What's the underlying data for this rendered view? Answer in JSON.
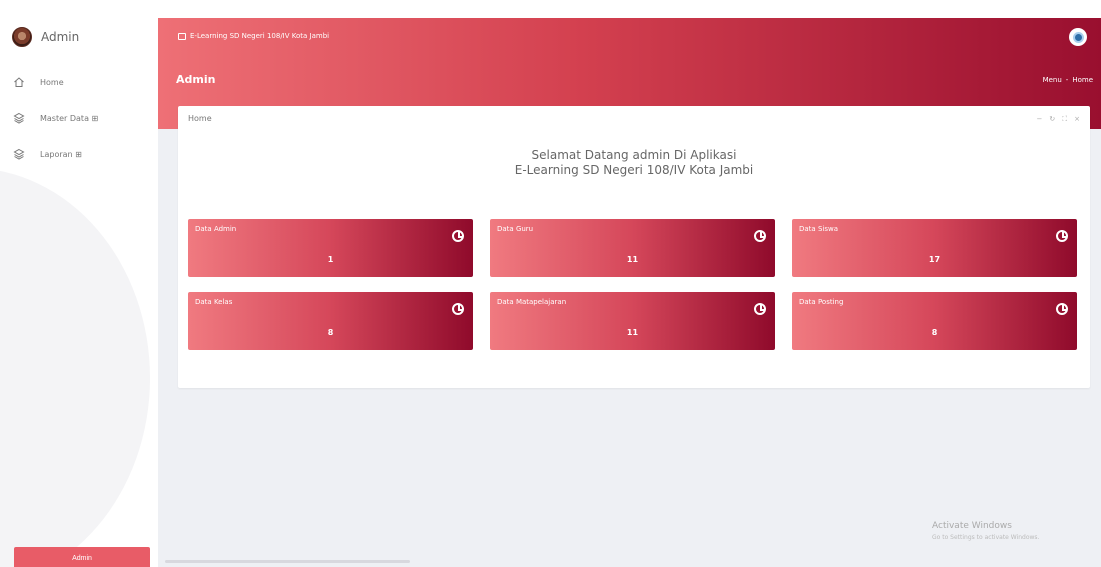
{
  "sidebar": {
    "brand": "Admin",
    "items": [
      {
        "label": "Home",
        "icon": "home-icon"
      },
      {
        "label": "Master Data ⊞",
        "icon": "layers-icon"
      },
      {
        "label": "Laporan ⊞",
        "icon": "layers-icon"
      }
    ],
    "footer_label": "Admin"
  },
  "header": {
    "app_title": "E-Learning SD Negeri 108/IV Kota Jambi",
    "page_title": "Admin",
    "breadcrumb": [
      "Menu",
      "-",
      "Home"
    ]
  },
  "card": {
    "title": "Home",
    "tools": [
      "−",
      "↻",
      "⛶",
      "×"
    ],
    "welcome_line1": "Selamat Datang admin Di Aplikasi",
    "welcome_line2": "E-Learning SD Negeri 108/IV Kota Jambi"
  },
  "tiles": [
    {
      "label": "Data Admin",
      "value": "1"
    },
    {
      "label": "Data Guru",
      "value": "11"
    },
    {
      "label": "Data Siswa",
      "value": "17"
    },
    {
      "label": "Data Kelas",
      "value": "8"
    },
    {
      "label": "Data Matapelajaran",
      "value": "11"
    },
    {
      "label": "Data Posting",
      "value": "8"
    }
  ],
  "watermark": {
    "title": "Activate Windows",
    "subtitle": "Go to Settings to activate Windows."
  },
  "colors": {
    "accent_light": "#ee7076",
    "accent_dark": "#990f2f"
  }
}
